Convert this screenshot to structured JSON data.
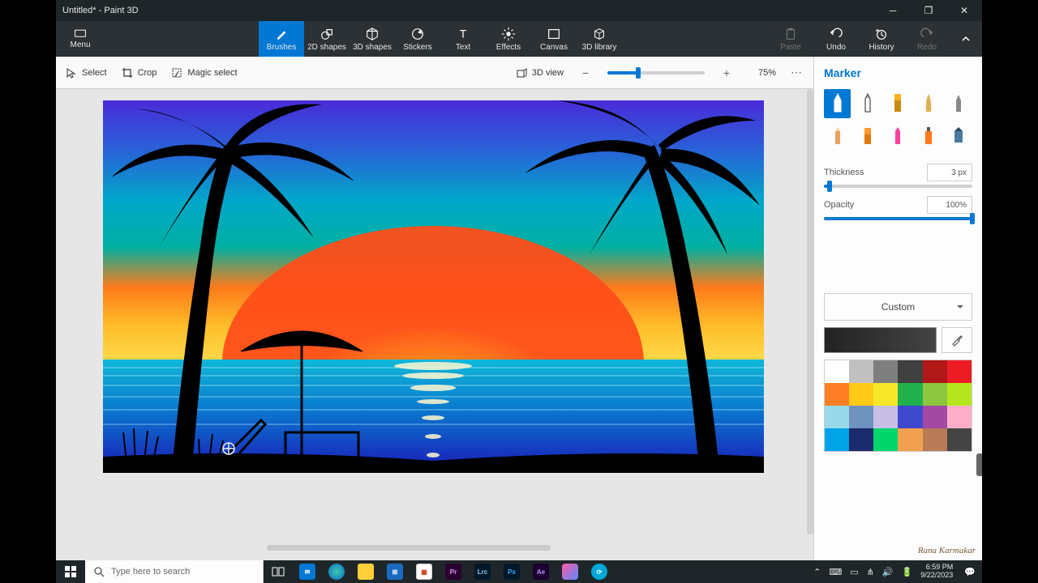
{
  "window": {
    "title": "Untitled* - Paint 3D"
  },
  "menu": {
    "label": "Menu"
  },
  "tools": {
    "brushes": "Brushes",
    "shapes2d": "2D shapes",
    "shapes3d": "3D shapes",
    "stickers": "Stickers",
    "text": "Text",
    "effects": "Effects",
    "canvas": "Canvas",
    "library3d": "3D library",
    "paste": "Paste",
    "undo": "Undo",
    "history": "History",
    "redo": "Redo"
  },
  "subtools": {
    "select": "Select",
    "crop": "Crop",
    "magic": "Magic select",
    "view3d": "3D view",
    "zoom": "75%"
  },
  "panel": {
    "title": "Marker",
    "thickness_label": "Thickness",
    "thickness_value": "3 px",
    "opacity_label": "Opacity",
    "opacity_value": "100%",
    "material": "Custom"
  },
  "palette": [
    "#ffffff",
    "#c0c0c0",
    "#7f7f7f",
    "#404040",
    "#b01818",
    "#ed1c24",
    "#ff7f27",
    "#ffca18",
    "#f6e72b",
    "#22b14c",
    "#8cc63f",
    "#b5e61d",
    "#99d9ea",
    "#7092be",
    "#c8bfe7",
    "#3f48cc",
    "#a349a4",
    "#ffaec9",
    "#00a2e8",
    "#1b2a6b",
    "#00d66b",
    "#f0a050",
    "#b97a57",
    "#444444"
  ],
  "taskbar": {
    "search_placeholder": "Type here to search",
    "time": "6:59 PM",
    "date": "9/22/2023"
  },
  "signature": "Rana Karmakar"
}
